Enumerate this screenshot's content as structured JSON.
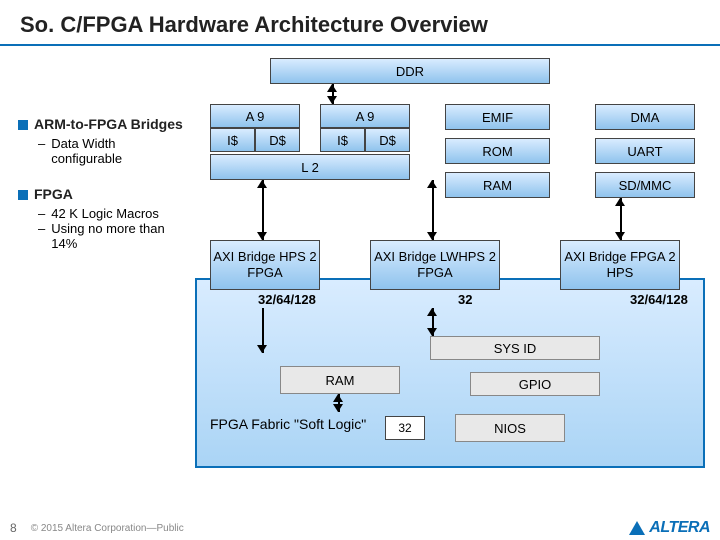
{
  "title": "So. C/FPGA Hardware Architecture Overview",
  "bullets": {
    "b1": {
      "label": "ARM-to-FPGA Bridges",
      "sub1": "Data Width configurable"
    },
    "b2": {
      "label": "FPGA",
      "sub1": "42 K Logic Macros",
      "sub2": "Using no more than 14%"
    }
  },
  "blocks": {
    "ddr": "DDR",
    "a9_1": "A 9",
    "a9_2": "A 9",
    "i1": "I$",
    "d1": "D$",
    "i2": "I$",
    "d2": "D$",
    "l2": "L 2",
    "emif": "EMIF",
    "dma": "DMA",
    "rom": "ROM",
    "uart": "UART",
    "ram_hps": "RAM",
    "sdmmc": "SD/MMC",
    "axi1": "AXI Bridge HPS 2 FPGA",
    "axi2": "AXI Bridge LWHPS 2 FPGA",
    "axi3": "AXI Bridge FPGA 2 HPS",
    "bw1": "32/64/128",
    "bw2": "32",
    "bw3": "32/64/128",
    "sysid": "SYS ID",
    "ram_fpga": "RAM",
    "gpio": "GPIO",
    "nios": "NIOS",
    "width32": "32",
    "fabric": "FPGA Fabric \"Soft Logic\""
  },
  "footer": {
    "page": "8",
    "copyright": "© 2015 Altera Corporation—Public",
    "brand": "ALTERA"
  }
}
